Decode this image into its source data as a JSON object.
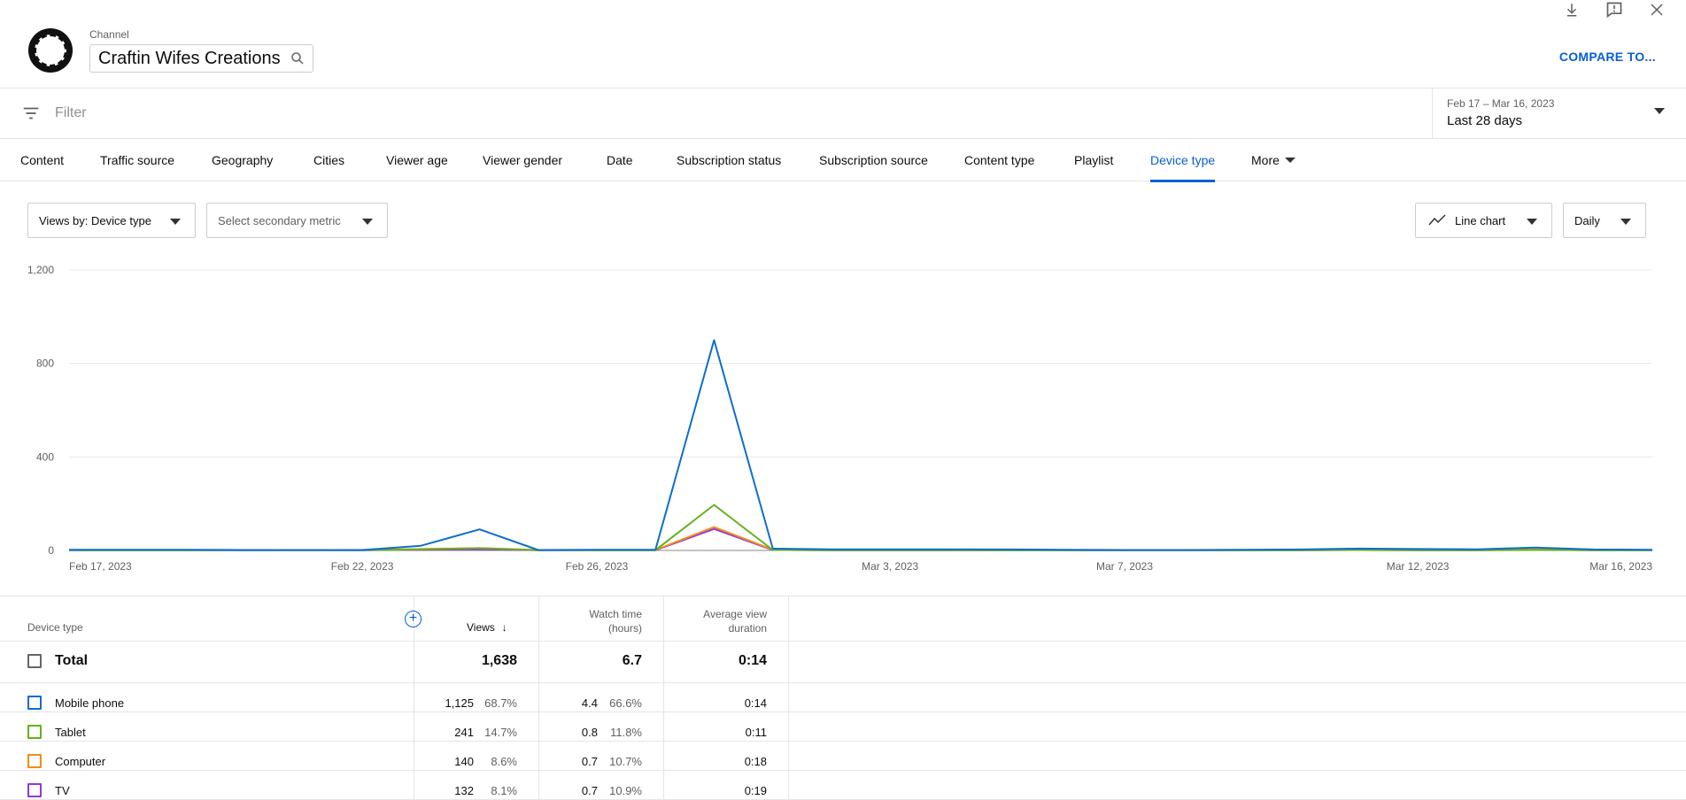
{
  "header": {
    "channel_label": "Channel",
    "channel_name": "Craftin Wifes Creations",
    "compare_label": "COMPARE TO..."
  },
  "filter": {
    "placeholder": "Filter",
    "date_range": "Feb 17 – Mar 16, 2023",
    "date_preset": "Last 28 days"
  },
  "tabs": [
    {
      "label": "Content"
    },
    {
      "label": "Traffic source"
    },
    {
      "label": "Geography"
    },
    {
      "label": "Cities"
    },
    {
      "label": "Viewer age"
    },
    {
      "label": "Viewer gender"
    },
    {
      "label": "Date"
    },
    {
      "label": "Subscription status"
    },
    {
      "label": "Subscription source"
    },
    {
      "label": "Content type"
    },
    {
      "label": "Playlist"
    },
    {
      "label": "Device type"
    },
    {
      "label": "More"
    }
  ],
  "active_tab": "Device type",
  "controls": {
    "primary_metric": "Views by: Device type",
    "secondary_metric": "Select secondary metric",
    "chart_type": "Line chart",
    "interval": "Daily"
  },
  "chart_data": {
    "type": "line",
    "x": [
      "Feb 17",
      "Feb 18",
      "Feb 19",
      "Feb 20",
      "Feb 21",
      "Feb 22",
      "Feb 23",
      "Feb 24",
      "Feb 25",
      "Feb 26",
      "Feb 27",
      "Feb 28",
      "Mar 1",
      "Mar 2",
      "Mar 3",
      "Mar 4",
      "Mar 5",
      "Mar 6",
      "Mar 7",
      "Mar 8",
      "Mar 9",
      "Mar 10",
      "Mar 11",
      "Mar 12",
      "Mar 13",
      "Mar 14",
      "Mar 15",
      "Mar 16"
    ],
    "tick_labels": [
      "Feb 17, 2023",
      "Feb 22, 2023",
      "Feb 26, 2023",
      "Mar 3, 2023",
      "Mar 7, 2023",
      "Mar 12, 2023",
      "Mar 16, 2023"
    ],
    "tick_positions": [
      0,
      5,
      9,
      14,
      18,
      23,
      27
    ],
    "ylim": [
      0,
      1200
    ],
    "yticks": [
      "0",
      "400",
      "800",
      "1,200"
    ],
    "ytick_values": [
      0,
      400,
      800,
      1200
    ],
    "series": [
      {
        "name": "Mobile phone",
        "color": "#0f6ecd",
        "values": [
          3,
          3,
          3,
          2,
          2,
          2,
          20,
          90,
          2,
          3,
          3,
          900,
          8,
          5,
          5,
          5,
          4,
          3,
          2,
          2,
          3,
          4,
          8,
          6,
          5,
          12,
          4,
          3
        ]
      },
      {
        "name": "Tablet",
        "color": "#65b11c",
        "values": [
          1,
          1,
          1,
          1,
          1,
          1,
          4,
          10,
          1,
          1,
          1,
          195,
          2,
          1,
          1,
          1,
          1,
          1,
          1,
          1,
          1,
          1,
          2,
          1,
          1,
          2,
          1,
          1
        ]
      },
      {
        "name": "Computer",
        "color": "#f28c18",
        "values": [
          2,
          2,
          2,
          2,
          1,
          2,
          6,
          10,
          2,
          2,
          2,
          100,
          3,
          2,
          2,
          2,
          2,
          2,
          1,
          1,
          2,
          2,
          4,
          2,
          2,
          4,
          2,
          2
        ]
      },
      {
        "name": "TV",
        "color": "#9334e6",
        "values": [
          1,
          1,
          1,
          1,
          1,
          1,
          3,
          5,
          1,
          1,
          1,
          92,
          2,
          1,
          1,
          1,
          1,
          1,
          1,
          1,
          1,
          1,
          2,
          1,
          1,
          3,
          1,
          1
        ]
      }
    ]
  },
  "table": {
    "headers": {
      "dimension": "Device type",
      "views": "Views",
      "watch_time_line1": "Watch time",
      "watch_time_line2": "(hours)",
      "avg_line1": "Average view",
      "avg_line2": "duration"
    },
    "total": {
      "label": "Total",
      "views": "1,638",
      "watch_time": "6.7",
      "avg": "0:14"
    },
    "rows": [
      {
        "label": "Mobile phone",
        "color": "#0f6ecd",
        "views": "1,125",
        "views_pct": "68.7%",
        "watch": "4.4",
        "watch_pct": "66.6%",
        "avg": "0:14"
      },
      {
        "label": "Tablet",
        "color": "#65b11c",
        "views": "241",
        "views_pct": "14.7%",
        "watch": "0.8",
        "watch_pct": "11.8%",
        "avg": "0:11"
      },
      {
        "label": "Computer",
        "color": "#f28c18",
        "views": "140",
        "views_pct": "8.6%",
        "watch": "0.7",
        "watch_pct": "10.7%",
        "avg": "0:18"
      },
      {
        "label": "TV",
        "color": "#9334e6",
        "views": "132",
        "views_pct": "8.1%",
        "watch": "0.7",
        "watch_pct": "10.9%",
        "avg": "0:19"
      }
    ]
  }
}
